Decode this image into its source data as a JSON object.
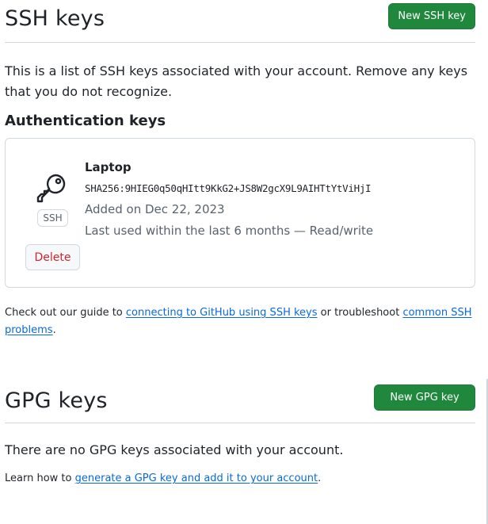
{
  "ssh": {
    "title": "SSH keys",
    "new_button_label": "New SSH key",
    "intro": "This is a list of SSH keys associated with your account. Remove any keys that you do not recognize.",
    "subheading": "Authentication keys",
    "keys": [
      {
        "name": "Laptop",
        "fingerprint": "SHA256:9HIEG0q50qHItt9KkG2+JS8W2gcX9L9AIHTtYtViHjI",
        "added": "Added on Dec 22, 2023",
        "last_used": "Last used within the last 6 months — Read/write",
        "badge": "SSH",
        "icon": "key-icon",
        "delete_label": "Delete"
      }
    ],
    "help": {
      "prefix": "Check out our guide to ",
      "link1": "connecting to GitHub using SSH keys",
      "middle": " or troubleshoot ",
      "link2": "common SSH problems",
      "suffix": "."
    }
  },
  "gpg": {
    "title": "GPG keys",
    "new_button_label": "New GPG key",
    "empty_message": "There are no GPG keys associated with your account.",
    "help": {
      "prefix": "Learn how to ",
      "link": "generate a GPG key and add it to your account",
      "suffix": "."
    }
  },
  "colors": {
    "primary_button": "#1f883d",
    "link": "#0969da",
    "danger": "#d1242f",
    "border": "#d1d9e0",
    "muted_text": "#59636e"
  }
}
